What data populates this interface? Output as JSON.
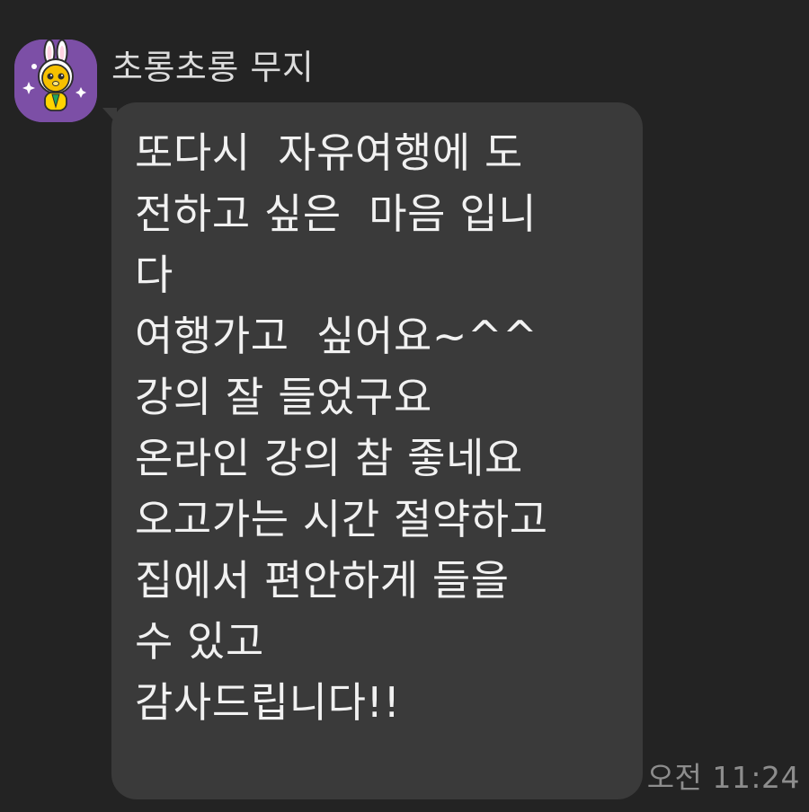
{
  "conversation": {
    "sender": {
      "name": "초롱초롱 무지",
      "avatar": {
        "icon": "muzi-character-avatar-icon",
        "background": "#7c4fa6"
      }
    },
    "messages": [
      {
        "text": "또다시  자유여행에 도\n전하고 싶은  마음 입니\n다\n여행가고  싶어요~^^\n강의 잘 들었구요\n온라인 강의 참 좋네요\n오고가는 시간 절약하고\n집에서 편안하게 들을\n수 있고\n감사드립니다!!",
        "time": "오전 11:24"
      }
    ]
  },
  "colors": {
    "background": "#232323",
    "bubble": "#3a3a3a",
    "message_text": "#f1f1f1",
    "sender_name": "#dcdcdc",
    "timestamp": "#8d8d8d"
  }
}
